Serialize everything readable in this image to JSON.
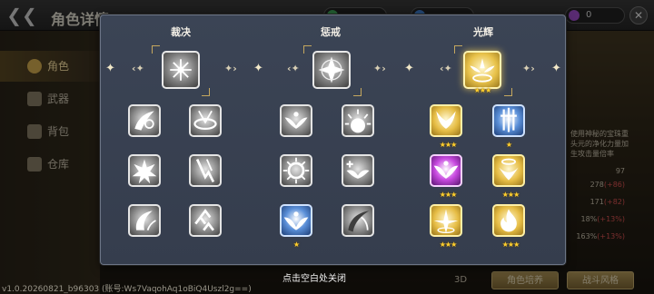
{
  "header": {
    "title": "角色详情",
    "back_label": "❮❮"
  },
  "resources": [
    {
      "icon": "green-gem-icon",
      "value": "",
      "color": "#3fa85a"
    },
    {
      "icon": "blue-gem-icon",
      "value": "",
      "color": "#3f7fd0"
    },
    {
      "icon": "purple-gem-icon",
      "value": "0",
      "color": "#a24fd0"
    }
  ],
  "sidebar": {
    "items": [
      {
        "label": "角色",
        "icon": "character-icon",
        "active": true
      },
      {
        "label": "武器",
        "icon": "weapon-icon",
        "active": false
      },
      {
        "label": "背包",
        "icon": "backpack-icon",
        "active": false
      },
      {
        "label": "仓库",
        "icon": "warehouse-icon",
        "active": false
      }
    ]
  },
  "right_panel": {
    "desc_lines": [
      "使用神秘的宝珠重",
      "头元的净化力量加",
      "生攻击量倍率"
    ],
    "stats": [
      {
        "value": "97",
        "delta": ""
      },
      {
        "value": "278",
        "delta": "(+86)"
      },
      {
        "value": "171",
        "delta": "(+82)"
      },
      {
        "value": "18%",
        "delta": "(+13%)"
      },
      {
        "value": "163%",
        "delta": "(+13%)"
      }
    ]
  },
  "footer": {
    "version": "v1.0.20260821_b96303 (账号:Ws7VaqohAq1oBiQ4Uszl2g==)",
    "label_3d": "3D",
    "buttons": [
      "角色培养",
      "战斗风格"
    ]
  },
  "modal": {
    "columns": [
      {
        "title": "裁决",
        "top_skill": {
          "icon": "judgment-burst-icon",
          "stars": 0,
          "rarity": "gray"
        },
        "skills": [
          {
            "icon": "vortex-slash-icon",
            "stars": 0,
            "rarity": "gray"
          },
          {
            "icon": "spiral-ring-icon",
            "stars": 0,
            "rarity": "gray"
          },
          {
            "icon": "shatter-burst-icon",
            "stars": 0,
            "rarity": "gray"
          },
          {
            "icon": "falling-strike-icon",
            "stars": 0,
            "rarity": "gray"
          },
          {
            "icon": "crescent-wave-icon",
            "stars": 0,
            "rarity": "gray"
          },
          {
            "icon": "ascending-arrows-icon",
            "stars": 0,
            "rarity": "gray"
          }
        ]
      },
      {
        "title": "惩戒",
        "top_skill": {
          "icon": "four-point-star-icon",
          "stars": 0,
          "rarity": "gray"
        },
        "skills": [
          {
            "icon": "winged-angel-icon",
            "stars": 0,
            "rarity": "gray"
          },
          {
            "icon": "sunrise-burst-icon",
            "stars": 0,
            "rarity": "gray"
          },
          {
            "icon": "sun-ring-icon",
            "stars": 0,
            "rarity": "gray"
          },
          {
            "icon": "winged-plus-icon",
            "stars": 0,
            "rarity": "gray"
          },
          {
            "icon": "angel-descent-icon",
            "stars": 1,
            "rarity": "blue"
          },
          {
            "icon": "shadow-claw-icon",
            "stars": 0,
            "rarity": "gray"
          }
        ]
      },
      {
        "title": "光辉",
        "top_skill": {
          "icon": "radiant-angel-icon",
          "stars": 3,
          "rarity": "gold"
        },
        "skills": [
          {
            "icon": "golden-wings-icon",
            "stars": 3,
            "rarity": "gold"
          },
          {
            "icon": "triple-sword-icon",
            "stars": 1,
            "rarity": "blue"
          },
          {
            "icon": "arcane-angel-icon",
            "stars": 3,
            "rarity": "purple"
          },
          {
            "icon": "halo-angel-icon",
            "stars": 3,
            "rarity": "gold"
          },
          {
            "icon": "holy-light-icon",
            "stars": 3,
            "rarity": "gold"
          },
          {
            "icon": "golden-flame-icon",
            "stars": 3,
            "rarity": "gold"
          }
        ]
      }
    ],
    "close_hint": "点击空白处关闭"
  }
}
